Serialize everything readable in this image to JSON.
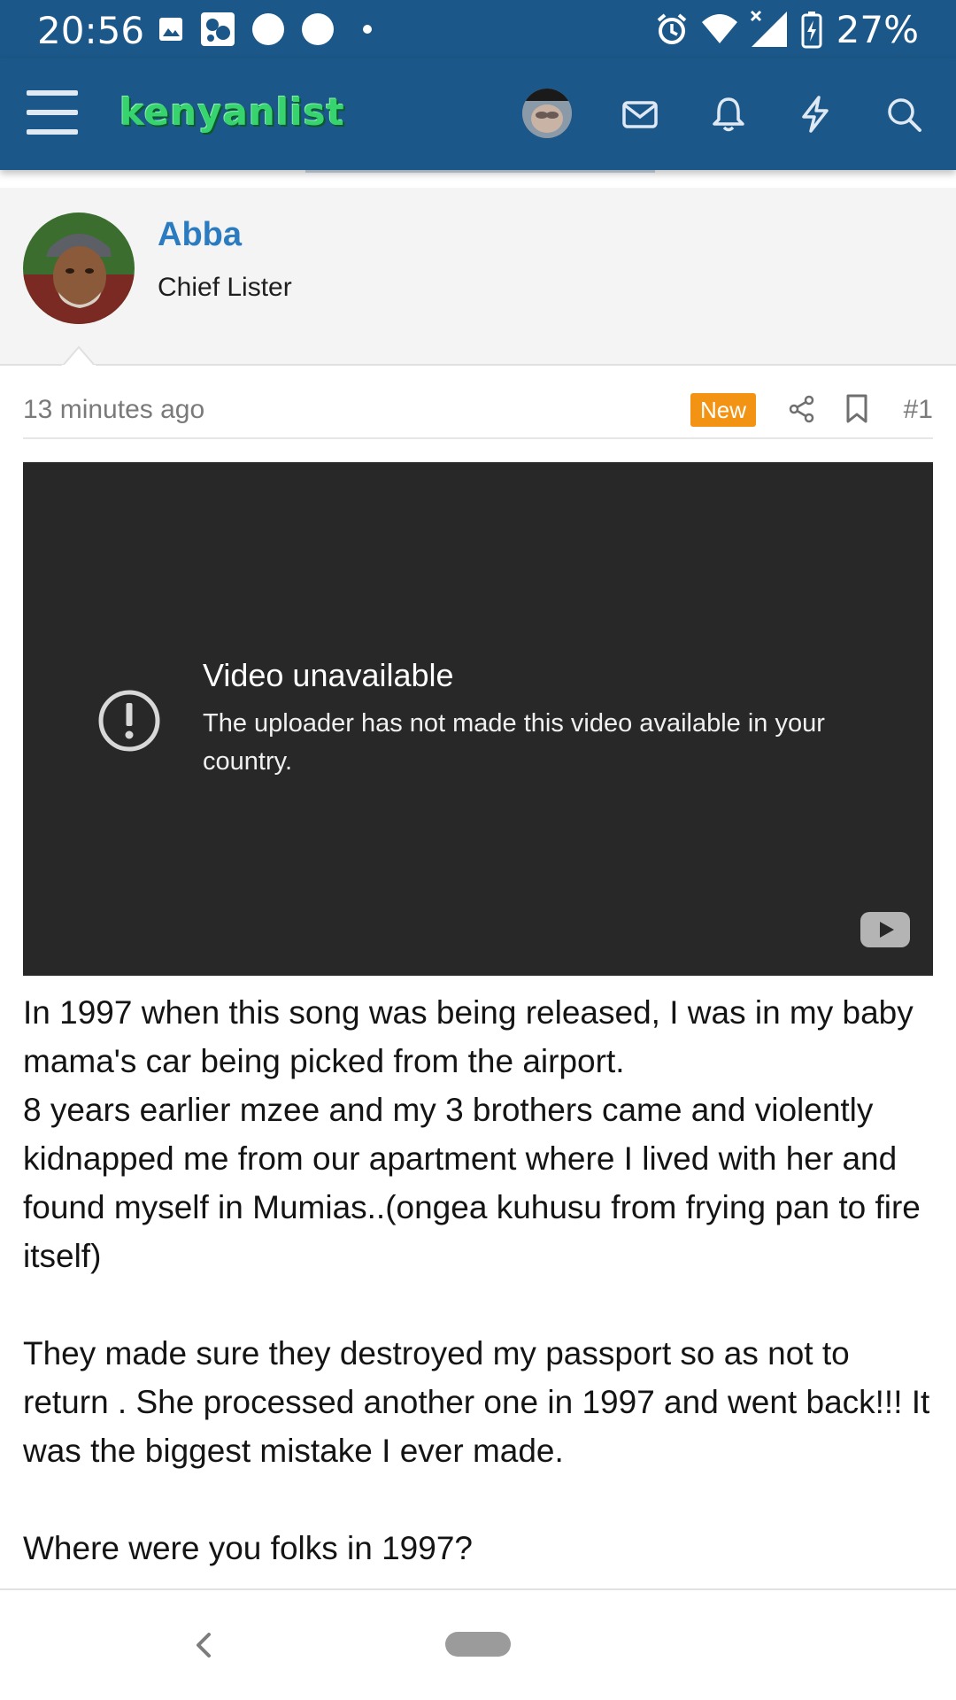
{
  "status_bar": {
    "time": "20:56",
    "battery": "27%",
    "left_icons": [
      "image-icon",
      "photo-app-icon",
      "circle-icon",
      "circle-icon",
      "dot-icon"
    ],
    "right_icons": [
      "alarm-icon",
      "wifi-icon",
      "signal-icon",
      "battery-charging-icon"
    ]
  },
  "header": {
    "logo": "kenyanlist",
    "icons": [
      "menu-icon",
      "user-avatar",
      "mail-icon",
      "bell-icon",
      "bolt-icon",
      "search-icon"
    ],
    "color": "#1b5788",
    "logo_color": "#36d36f"
  },
  "author": {
    "name": "Abba",
    "title": "Chief Lister",
    "name_color": "#2b7bc0"
  },
  "post": {
    "time": "13 minutes ago",
    "badge": "New",
    "badge_color": "#f39313",
    "number": "#1",
    "video": {
      "title": "Video unavailable",
      "message": "The uploader has not made this video available in your country."
    },
    "paragraphs": [
      "In 1997 when this song was being released, I was in my baby mama's car being picked from the airport.",
      "8 years earlier mzee and my 3 brothers came and violently kidnapped me from our apartment where I lived with her and found myself in Mumias..(ongea kuhusu from frying pan to fire itself)",
      "They made sure they destroyed my passport so as not to return . She processed another one in 1997 and went back!!! It was the biggest mistake I ever made.",
      "Where were you folks in 1997?"
    ]
  },
  "nav": {
    "back": "back-icon",
    "home": "home-pill"
  }
}
